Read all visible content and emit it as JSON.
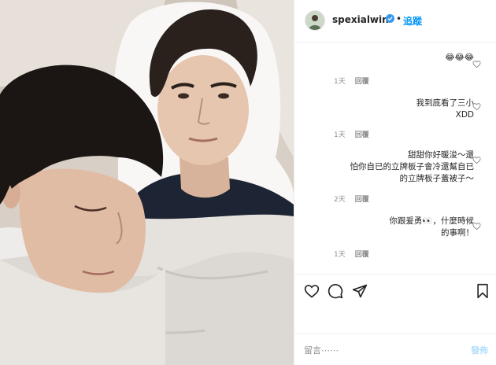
{
  "post": {
    "username": "spexialwin",
    "follow_label": "追蹤",
    "separator": "•"
  },
  "comments": [
    {
      "text": "😂😂😂",
      "time": "1天",
      "reply": "回覆"
    },
    {
      "text": "我到底看了三小\nXDD",
      "time": "1天",
      "reply": "回覆"
    },
    {
      "text": "甜甜你好暖浚～還\n怕你自已的立牌板子會冷還幫自已\n的立牌板子蓋被子～",
      "time": "2天",
      "reply": "回覆"
    },
    {
      "text": "你跟爰勇👀，什麼時候\n的事啊！",
      "time": "1天",
      "reply": "回覆"
    }
  ],
  "actions": {
    "like": "heart-icon",
    "comment": "comment-icon",
    "share": "share-icon",
    "save": "bookmark-icon"
  },
  "add_comment": {
    "placeholder": "留言⋯⋯",
    "post_label": "發佈"
  },
  "colors": {
    "accent": "#0095f6",
    "verified": "#3897f0",
    "muted": "#8e8e8e",
    "post_disabled": "#b2dffc"
  }
}
